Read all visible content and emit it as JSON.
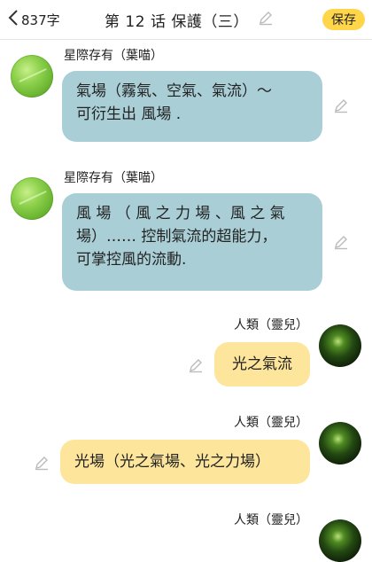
{
  "header": {
    "word_count": "837字",
    "title": "第 12 话 保護（三）",
    "save_label": "保存"
  },
  "messages": [
    {
      "speaker": "星際存有（葉喵）",
      "side": "left",
      "lines": [
        "氣場（霧氣、空氣、氣流）～",
        "可衍生出 風場 ."
      ]
    },
    {
      "speaker": "星際存有（葉喵）",
      "side": "left",
      "lines": [
        "風 場 （ 風 之 力 場 、風 之 氣",
        "場）…… 控制氣流的超能力，",
        "可掌控風的流動."
      ]
    },
    {
      "speaker": "人類（靈兒）",
      "side": "right",
      "lines": [
        "光之氣流"
      ]
    },
    {
      "speaker": "人類（靈兒）",
      "side": "right",
      "lines": [
        "光場（光之氣場、光之力場）"
      ]
    },
    {
      "speaker": "人類（靈兒）",
      "side": "right",
      "lines": []
    }
  ],
  "colors": {
    "accent": "#ffd64a",
    "left_bubble": "#a9ced6",
    "right_bubble": "#fde69b"
  }
}
